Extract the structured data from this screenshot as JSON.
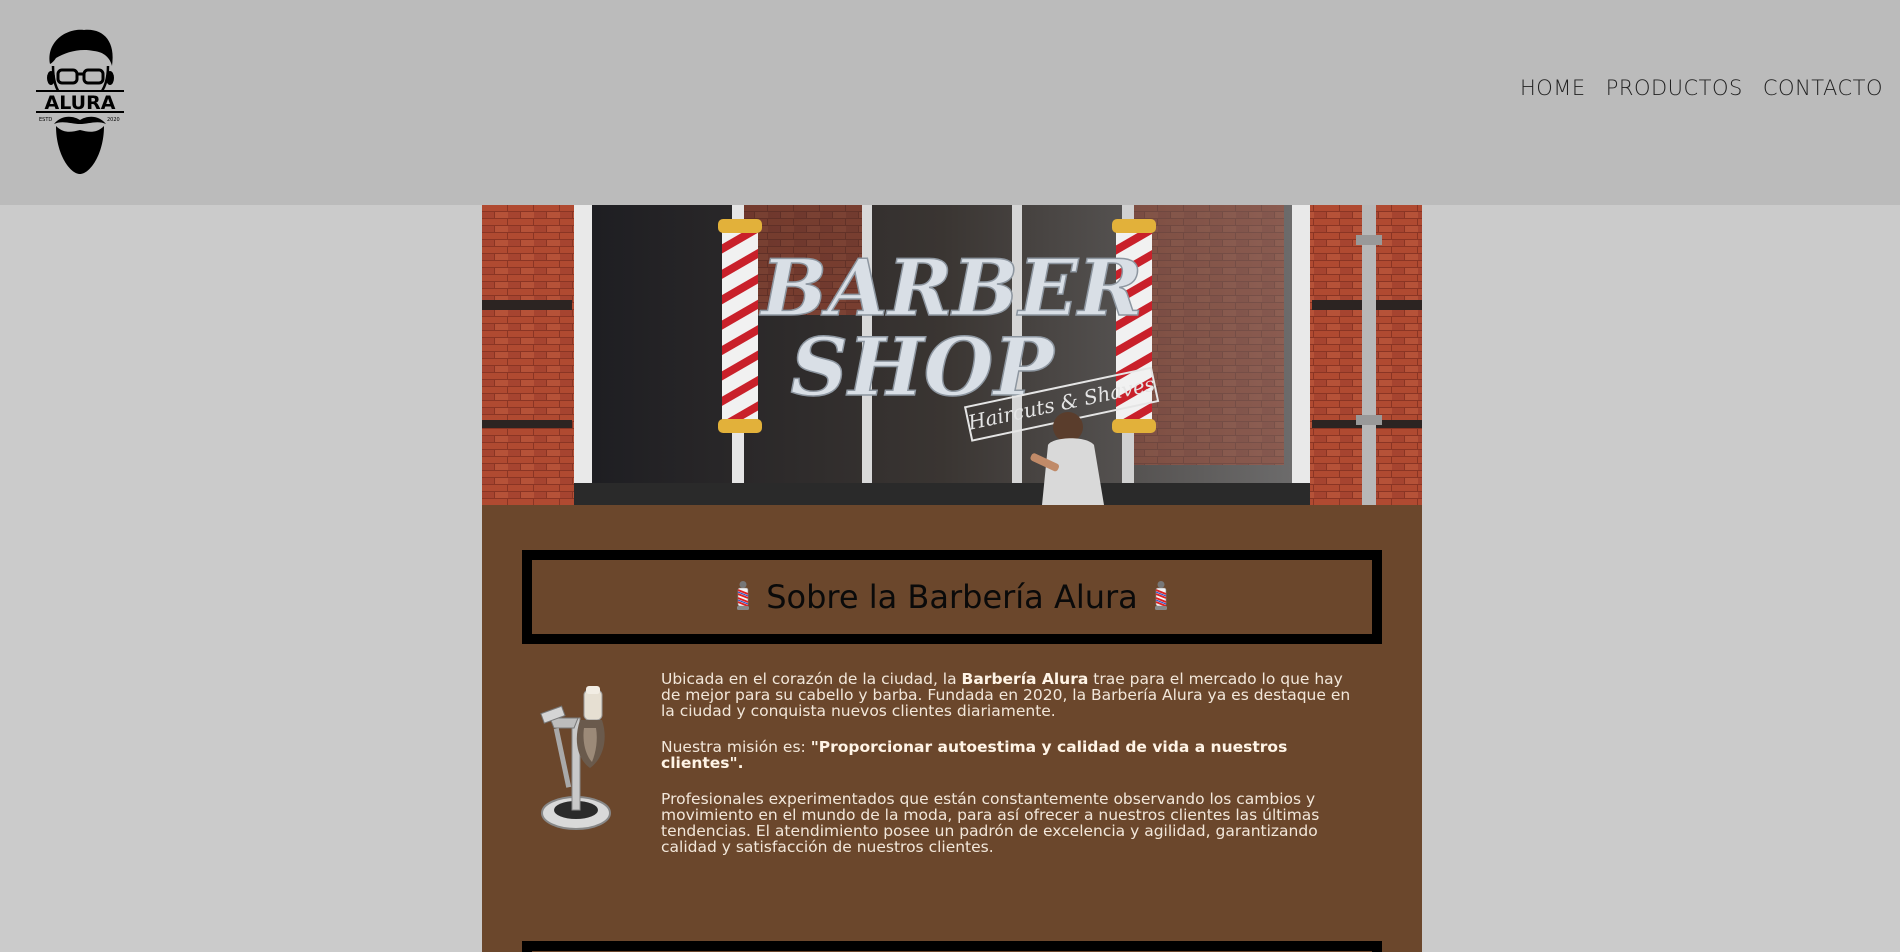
{
  "header": {
    "logo": {
      "brand_text": "ALURA",
      "estd_left": "ESTD",
      "estd_right": "2020"
    },
    "nav": [
      {
        "label": "HOME"
      },
      {
        "label": "PRODUCTOS"
      },
      {
        "label": "CONTACTO"
      }
    ]
  },
  "hero": {
    "sign_line1": "BARBER",
    "sign_line2": "SHOP",
    "sign_tagline": "Haircuts & Shaves"
  },
  "about": {
    "title": "Sobre la Barbería Alura",
    "p1_before": "Ubicada en el corazón de la ciudad, la ",
    "p1_strong": "Barbería Alura",
    "p1_after": " trae para el mercado lo que hay de mejor para su cabello y barba. Fundada en 2020, la Barbería Alura ya es destaque en la ciudad y conquista nuevos clientes diariamente.",
    "p2_before": "Nuestra misión es: ",
    "p2_strong": "\"Proporcionar autoestima y calidad de vida a nuestros clientes\".",
    "p3": "Profesionales experimentados que están constantemente observando los cambios y movimiento en el mundo de la moda, para así ofrecer a nuestros clientes las últimas tendencias. El atendimiento posee un padrón de excelencia y agilidad, garantizando calidad y satisfacción de nuestros clientes."
  },
  "colors": {
    "header_bg": "#bbbbbb",
    "page_bg": "#cbcbcb",
    "main_bg": "#6b472c",
    "text_light": "#f2e7da",
    "border": "#000000"
  },
  "icons": {
    "logo": "bearded-man-logo",
    "pole": "barber-pole-icon",
    "about_image": "razor-brush-stand"
  }
}
